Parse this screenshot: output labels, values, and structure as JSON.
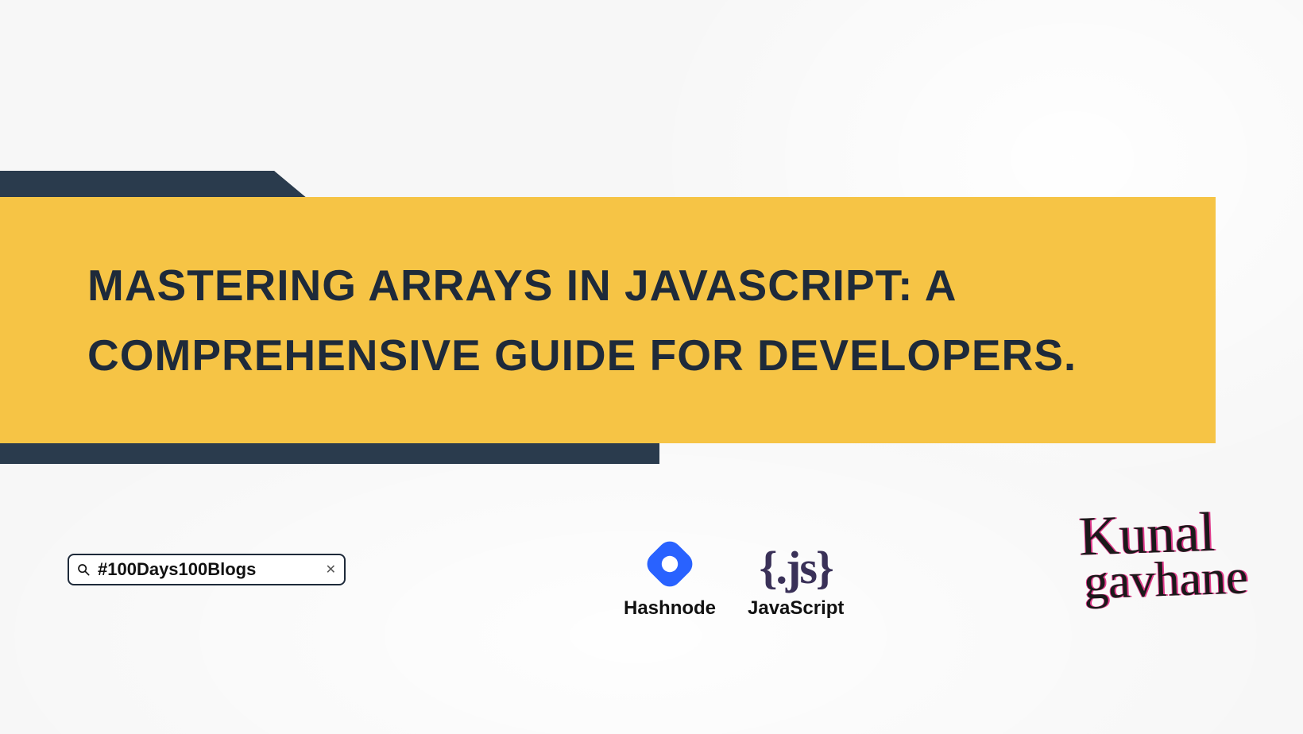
{
  "title": "MASTERING ARRAYS IN JAVASCRIPT: A COMPREHENSIVE GUIDE FOR DEVELOPERS.",
  "search": {
    "value": "#100Days100Blogs"
  },
  "logos": {
    "hashnode": {
      "label": "Hashnode"
    },
    "javascript": {
      "braces": "{.js}",
      "label": "JavaScript"
    }
  },
  "signature": {
    "line1": "Kunal",
    "line2": "gavhane"
  },
  "colors": {
    "yellow": "#f6c445",
    "dark": "#2a3b4d",
    "hashnode_blue": "#2962ff",
    "js_purple": "#3a3158",
    "signature_pink": "#e03a8c"
  }
}
